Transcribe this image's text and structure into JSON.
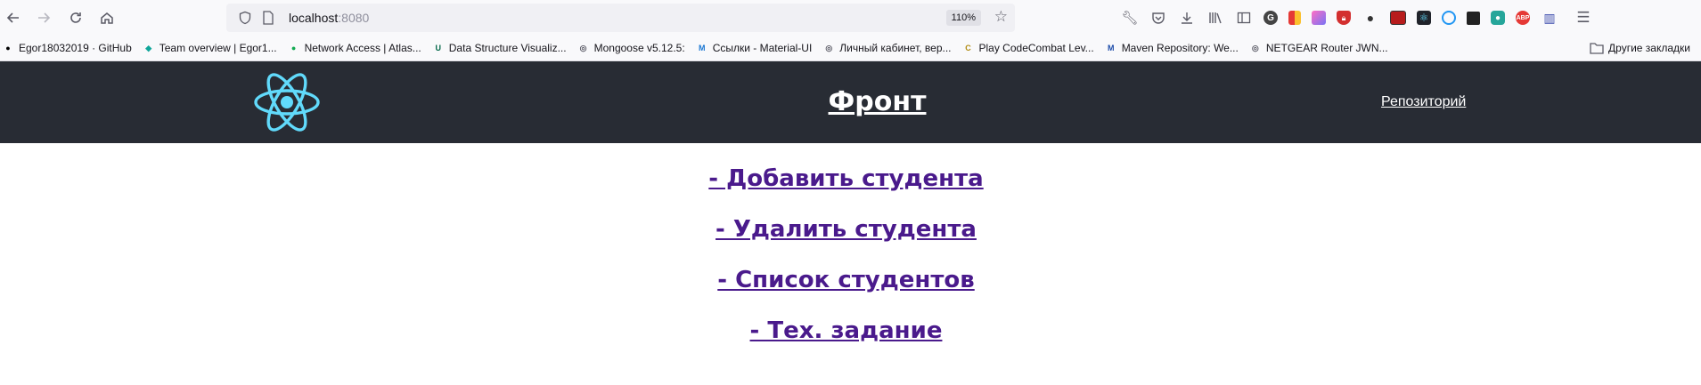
{
  "browser": {
    "url_host": "localhost",
    "url_port": ":8080",
    "zoom": "110%",
    "bookmarks": [
      {
        "label": "Egor18032019 · GitHub",
        "icon": "github-icon",
        "color": "#000000"
      },
      {
        "label": "Team overview | Egor1...",
        "icon": "diamond-icon",
        "color": "#10a69a"
      },
      {
        "label": "Network Access | Atlas...",
        "icon": "mongodb-leaf-icon",
        "color": "#13aa52"
      },
      {
        "label": "Data Structure Visualiz...",
        "icon": "usf-icon",
        "color": "#006747"
      },
      {
        "label": "Mongoose v5.12.5:",
        "icon": "globe-icon",
        "color": "#5b5b66"
      },
      {
        "label": "Ссылки - Material-UI",
        "icon": "material-ui-icon",
        "color": "#1976d2"
      },
      {
        "label": "Личный кабинет, вер...",
        "icon": "globe-icon",
        "color": "#5b5b66"
      },
      {
        "label": "Play CodeCombat Lev...",
        "icon": "codecombat-icon",
        "color": "#b08a10"
      },
      {
        "label": "Maven Repository: We...",
        "icon": "maven-icon",
        "color": "#1a4aa8"
      },
      {
        "label": "NETGEAR Router JWN...",
        "icon": "globe-icon",
        "color": "#5b5b66"
      }
    ],
    "other_bookmarks": "Другие закладки"
  },
  "app": {
    "title": "Фронт",
    "repo_link": "Репозиторий",
    "accent": "#61dafb",
    "menu": [
      "- Добавить студента",
      "- Удалить студента",
      "- Список студентов",
      "- Тех. задание"
    ]
  }
}
